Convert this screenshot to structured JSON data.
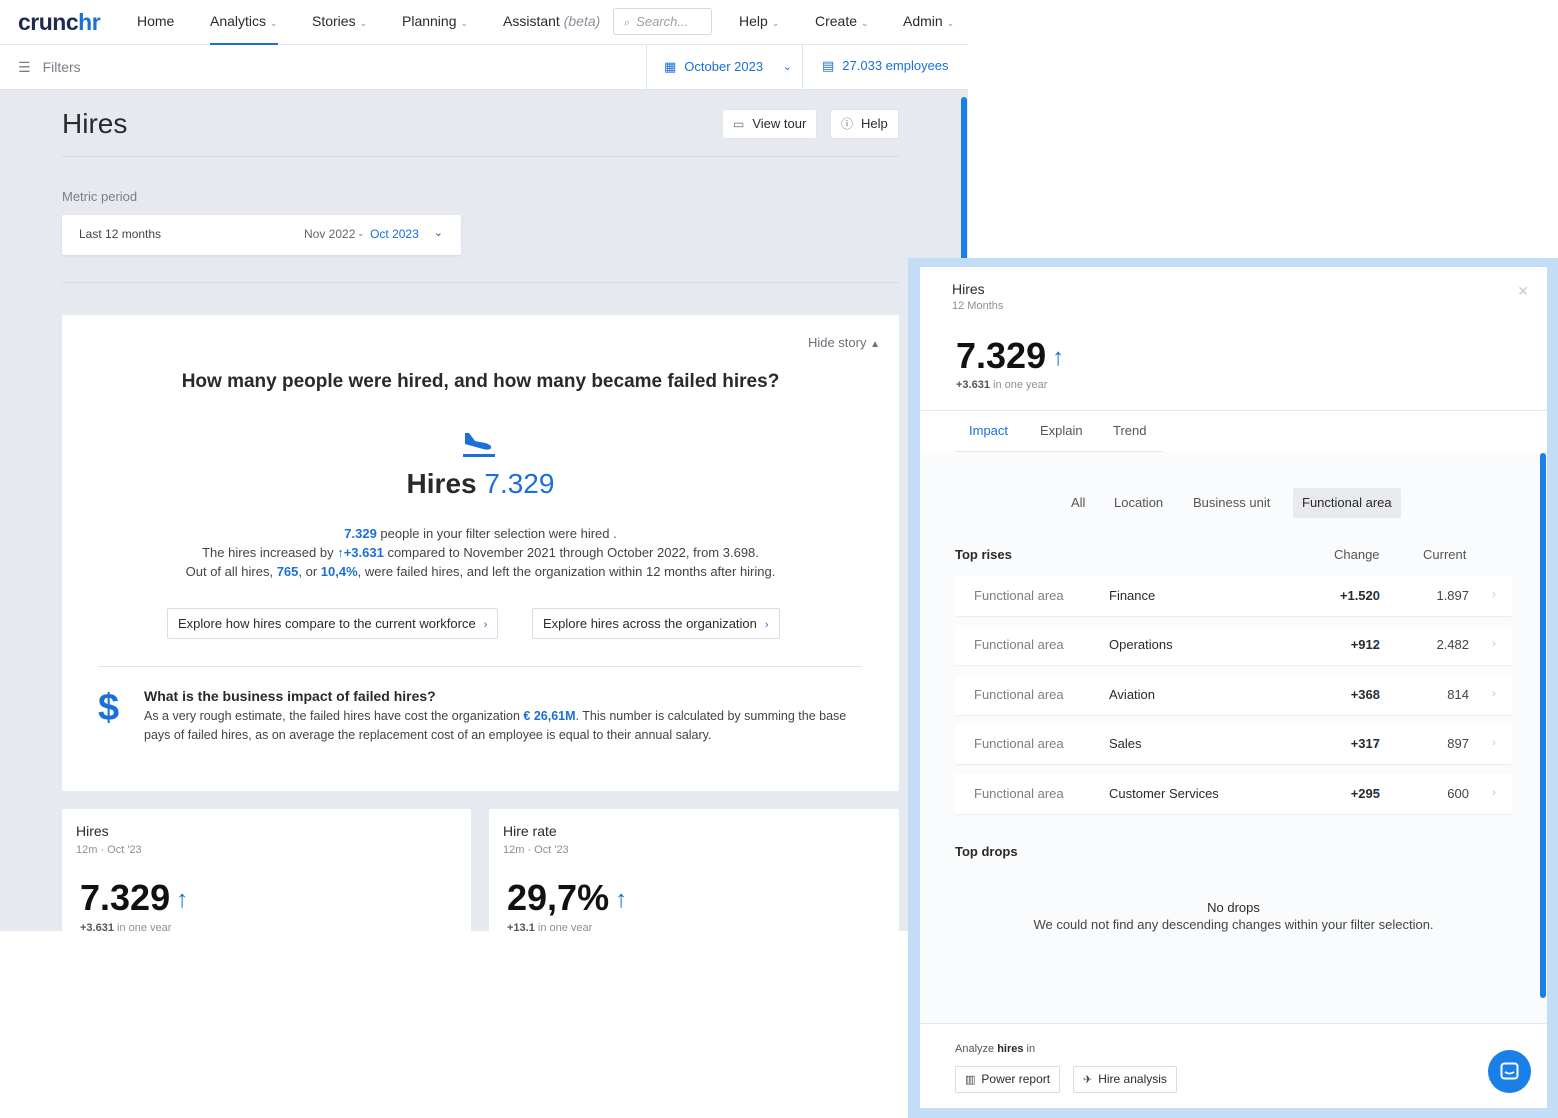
{
  "nav": {
    "logo_a": "crunc",
    "logo_b": "hr",
    "items": [
      {
        "label": "Home"
      },
      {
        "label": "Analytics"
      },
      {
        "label": "Stories"
      },
      {
        "label": "Planning"
      },
      {
        "label": "Assistant",
        "badge": "(beta)"
      },
      {
        "label": "Help"
      },
      {
        "label": "Create"
      },
      {
        "label": "Admin"
      }
    ],
    "search_placeholder": "Search..."
  },
  "filterbar": {
    "filters_label": "Filters",
    "date": "October 2023",
    "employees": "27.033 employees"
  },
  "page": {
    "title": "Hires",
    "view_tour": "View tour",
    "help": "Help",
    "metric_period_label": "Metric period",
    "period_name": "Last 12 months",
    "period_from": "Nov 2022",
    "period_sep": "-",
    "period_to": "Oct 2023"
  },
  "story": {
    "hide_story": "Hide story",
    "question": "How many people were hired, and how many became failed hires?",
    "stat_label": "Hires",
    "stat_value": "7.329",
    "line1_value": "7.329",
    "line1_text": " people in your filter selection were hired .",
    "line2_a": "The hires increased by ",
    "line2_value": "+3.631",
    "line2_b": " compared to November 2021 through October 2022, from 3.698.",
    "line3_a": "Out of all hires, ",
    "line3_v1": "765",
    "line3_b": ", or ",
    "line3_v2": "10,4%",
    "line3_c": ", were failed hires, and left the organization within 12 months after hiring.",
    "explore1": "Explore how hires compare to the current workforce",
    "explore2": "Explore hires across the organization",
    "biz_question": "What is the business impact of failed hires?",
    "biz_a": "As a very rough estimate, the failed hires have cost the organization ",
    "biz_value": "€ 26,61M",
    "biz_b": ". This number is calculated by summing the base pays of failed hires, as on average the replacement cost of an employee is equal to their annual salary."
  },
  "cards": [
    {
      "title": "Hires",
      "sub": "12m · Oct '23",
      "value": "7.329",
      "delta": "+3.631",
      "delta_text": " in one year"
    },
    {
      "title": "Hire rate",
      "sub": "12m · Oct '23",
      "value": "29,7%",
      "delta": "+13.1",
      "delta_text": " in one year"
    }
  ],
  "panel": {
    "title": "Hires",
    "sub": "12 Months",
    "value": "7.329",
    "delta": "+3.631",
    "delta_text": " in one year",
    "tabs": [
      "Impact",
      "Explain",
      "Trend"
    ],
    "segments": [
      "All",
      "Location",
      "Business unit",
      "Functional area"
    ],
    "top_rises": "Top rises",
    "col_change": "Change",
    "col_current": "Current",
    "rows": [
      {
        "dim": "Functional area",
        "name": "Finance",
        "change": "+1.520",
        "current": "1.897"
      },
      {
        "dim": "Functional area",
        "name": "Operations",
        "change": "+912",
        "current": "2.482"
      },
      {
        "dim": "Functional area",
        "name": "Aviation",
        "change": "+368",
        "current": "814"
      },
      {
        "dim": "Functional area",
        "name": "Sales",
        "change": "+317",
        "current": "897"
      },
      {
        "dim": "Functional area",
        "name": "Customer Services",
        "change": "+295",
        "current": "600"
      }
    ],
    "top_drops": "Top drops",
    "no_drops_title": "No drops",
    "no_drops_text": "We could not find any descending changes within your filter selection.",
    "analyze_a": "Analyze ",
    "analyze_b": "hires",
    "analyze_c": " in",
    "btn_power": "Power report",
    "btn_hire": "Hire analysis"
  },
  "colors": {
    "accent": "#1a6fd8",
    "background": "#e6e9f0"
  }
}
